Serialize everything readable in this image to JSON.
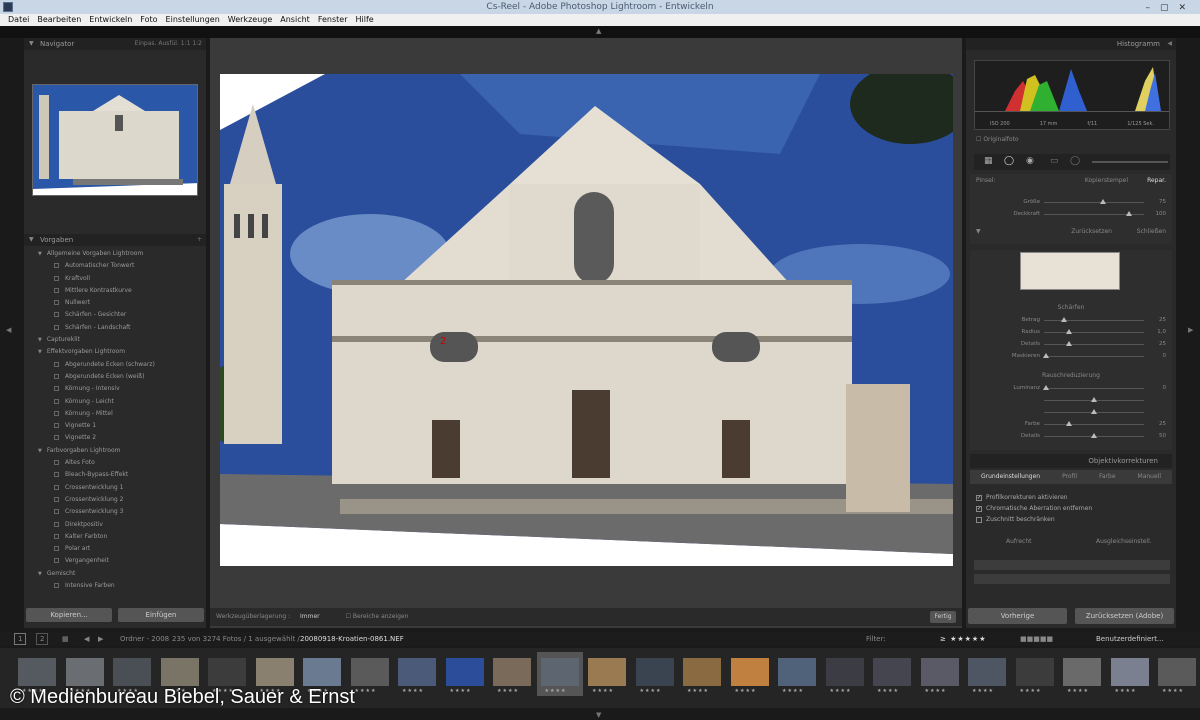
{
  "window": {
    "title": "Cs-Reel - Adobe Photoshop Lightroom - Entwickeln"
  },
  "menu": [
    "Datei",
    "Bearbeiten",
    "Entwickeln",
    "Foto",
    "Einstellungen",
    "Werkzeuge",
    "Ansicht",
    "Fenster",
    "Hilfe"
  ],
  "navigator": {
    "title": "Navigator",
    "modes": "Einpas.  Ausfül.  1:1  1:2"
  },
  "presets": {
    "title": "Vorgaben",
    "rows": [
      {
        "type": "folder",
        "label": "Allgemeine Vorgaben Lightroom"
      },
      {
        "type": "item",
        "label": "Automatischer Tonwert"
      },
      {
        "type": "item",
        "label": "Kraftvoll"
      },
      {
        "type": "item",
        "label": "Mittlere Kontrastkurve"
      },
      {
        "type": "item",
        "label": "Nullwert"
      },
      {
        "type": "item",
        "label": "Schärfen - Gesichter"
      },
      {
        "type": "item",
        "label": "Schärfen - Landschaft"
      },
      {
        "type": "folder",
        "label": "Captureklit"
      },
      {
        "type": "folder",
        "label": "Effektvorgaben Lightroom"
      },
      {
        "type": "item",
        "label": "Abgerundete Ecken (schwarz)"
      },
      {
        "type": "item",
        "label": "Abgerundete Ecken (weiß)"
      },
      {
        "type": "item",
        "label": "Körnung - Intensiv"
      },
      {
        "type": "item",
        "label": "Körnung - Leicht"
      },
      {
        "type": "item",
        "label": "Körnung - Mittel"
      },
      {
        "type": "item",
        "label": "Vignette 1"
      },
      {
        "type": "item",
        "label": "Vignette 2"
      },
      {
        "type": "folder",
        "label": "Farbvorgaben Lightroom"
      },
      {
        "type": "item",
        "label": "Altes Foto"
      },
      {
        "type": "item",
        "label": "Bleach-Bypass-Effekt"
      },
      {
        "type": "item",
        "label": "Crossentwicklung 1"
      },
      {
        "type": "item",
        "label": "Crossentwicklung 2"
      },
      {
        "type": "item",
        "label": "Crossentwicklung 3"
      },
      {
        "type": "item",
        "label": "Direktpositiv"
      },
      {
        "type": "item",
        "label": "Kalter Farbton"
      },
      {
        "type": "item",
        "label": "Polar art"
      },
      {
        "type": "item",
        "label": "Vergangenheit"
      },
      {
        "type": "folder",
        "label": "Gemischt"
      },
      {
        "type": "item",
        "label": "Intensive Farben"
      }
    ]
  },
  "left_buttons": {
    "copy": "Kopieren...",
    "paste": "Einfügen"
  },
  "center_toolbar": {
    "overlay_label": "Werkzeugüberlagerung :",
    "overlay_value": "Immer",
    "show_spots": "Bereiche anzeigen",
    "done": "Fertig"
  },
  "histogram": {
    "title": "Histogramm",
    "labels": [
      "ISO 200",
      "17 mm",
      "f/11",
      "1/125 Sek."
    ],
    "original": "Originalfoto"
  },
  "brush": {
    "pinsel": "Pinsel:",
    "mode_a": "Kopierstempel",
    "mode_b": "Repar.",
    "size_label": "Größe",
    "size_val": "75",
    "opacity_label": "Deckkraft",
    "opacity_val": "100",
    "reset": "Zurücksetzen",
    "close": "Schließen"
  },
  "detail": {
    "sharpen_title": "Schärfen",
    "sharpen": [
      {
        "label": "Betrag",
        "value": "25",
        "pos": 0.2
      },
      {
        "label": "Radius",
        "value": "1,0",
        "pos": 0.25
      },
      {
        "label": "Details",
        "value": "25",
        "pos": 0.25
      },
      {
        "label": "Maskieren",
        "value": "0",
        "pos": 0.02
      }
    ],
    "noise_title": "Rauschreduzierung",
    "noise": [
      {
        "label": "Luminanz",
        "value": "0",
        "pos": 0.02
      },
      {
        "label": "",
        "value": "",
        "pos": 0.5
      },
      {
        "label": "",
        "value": "",
        "pos": 0.5
      },
      {
        "label": "Farbe",
        "value": "25",
        "pos": 0.25
      },
      {
        "label": "Details",
        "value": "50",
        "pos": 0.5
      }
    ]
  },
  "lens": {
    "title": "Objektivkorrekturen",
    "tabs": [
      "Grundeinstellungen",
      "Profil",
      "Farbe",
      "Manuell"
    ],
    "checks": [
      {
        "label": "Profilkorrekturen aktivieren",
        "checked": true
      },
      {
        "label": "Chromatische Aberration entfernen",
        "checked": true
      },
      {
        "label": "Zuschnitt beschränken",
        "checked": false
      }
    ],
    "auto": "Aufrecht",
    "aus": "Ausgleichseinstell."
  },
  "right_buttons": {
    "previous": "Vorherige",
    "reset": "Zurücksetzen (Adobe)"
  },
  "filmbar": {
    "pages": [
      "1",
      "2"
    ],
    "path": "Ordner - 2008",
    "count": "235 von 3274 Fotos / 1 ausgewählt /",
    "filename": "20080918-Kroatien-0861.NEF",
    "filter": "Filter:",
    "custom": "Benutzerdefiniert..."
  },
  "copyright": "© Medienbureau Biebel, Sauer & Ernst",
  "colors": {
    "accent": "#a8a8a8",
    "bg": "#2a2a2a",
    "sky": "#1f4a9a"
  }
}
